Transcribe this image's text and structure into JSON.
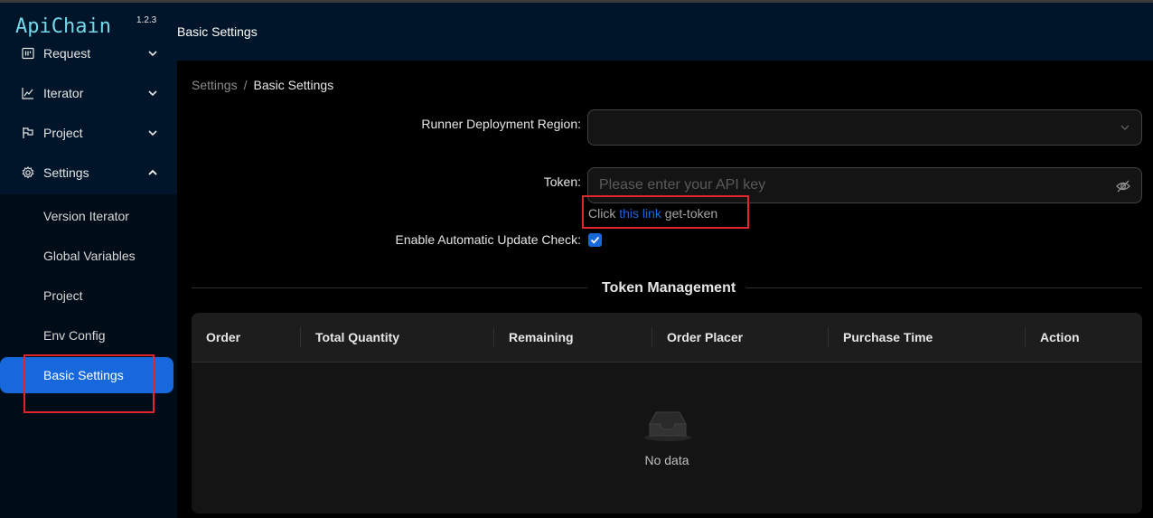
{
  "app": {
    "name": "ApiChain",
    "version": "1.2.3"
  },
  "sidebar": {
    "items": [
      {
        "label": "Request",
        "icon": "request-icon"
      },
      {
        "label": "Iterator",
        "icon": "chart-icon"
      },
      {
        "label": "Project",
        "icon": "flag-icon"
      },
      {
        "label": "Settings",
        "icon": "gear-icon"
      }
    ],
    "settings_submenu": [
      {
        "label": "Version Iterator"
      },
      {
        "label": "Global Variables"
      },
      {
        "label": "Project"
      },
      {
        "label": "Env Config"
      },
      {
        "label": "Basic Settings",
        "active": true
      }
    ]
  },
  "header": {
    "title": "Basic Settings"
  },
  "breadcrumb": {
    "parent": "Settings",
    "separator": "/",
    "current": "Basic Settings"
  },
  "form": {
    "region_label": "Runner Deployment Region:",
    "region_value": "",
    "token_label": "Token:",
    "token_placeholder": "Please enter your API key",
    "hint_prefix": "Click ",
    "hint_link": "this link",
    "hint_suffix": " get-token",
    "auto_update_label": "Enable Automatic Update Check:",
    "auto_update_checked": true
  },
  "token_management": {
    "title": "Token Management",
    "columns": [
      "Order",
      "Total Quantity",
      "Remaining",
      "Order Placer",
      "Purchase Time",
      "Action"
    ],
    "rows": [],
    "empty_text": "No data"
  },
  "colors": {
    "accent": "#1668dc",
    "sidebar_bg": "#001529",
    "highlight_box": "#e0252b",
    "logo": "#74d7e8"
  }
}
